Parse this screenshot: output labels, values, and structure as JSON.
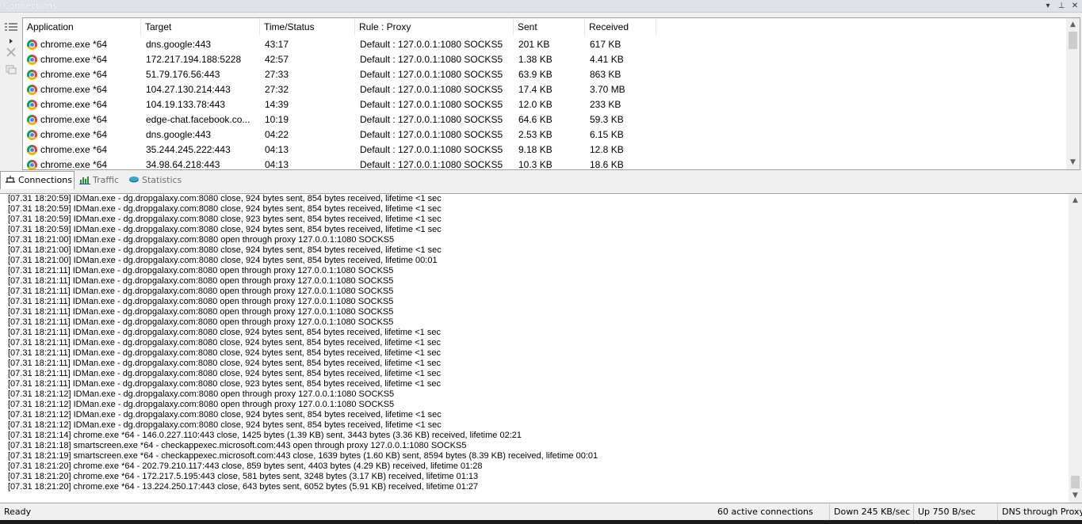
{
  "window": {
    "title": "Connections",
    "controls": {
      "dropdown": "▾",
      "pin": "⊥",
      "close": "✕"
    }
  },
  "connections": {
    "columns": [
      "Application",
      "Target",
      "Time/Status",
      "Rule : Proxy",
      "Sent",
      "Received"
    ],
    "rows": [
      [
        "chrome.exe *64",
        "dns.google:443",
        "43:17",
        "Default : 127.0.0.1:1080 SOCKS5",
        "201 KB",
        "617 KB"
      ],
      [
        "chrome.exe *64",
        "172.217.194.188:5228",
        "42:57",
        "Default : 127.0.0.1:1080 SOCKS5",
        "1.38 KB",
        "4.41 KB"
      ],
      [
        "chrome.exe *64",
        "51.79.176.56:443",
        "27:33",
        "Default : 127.0.0.1:1080 SOCKS5",
        "63.9 KB",
        "863 KB"
      ],
      [
        "chrome.exe *64",
        "104.27.130.214:443",
        "27:32",
        "Default : 127.0.0.1:1080 SOCKS5",
        "17.4 KB",
        "3.70 MB"
      ],
      [
        "chrome.exe *64",
        "104.19.133.78:443",
        "14:39",
        "Default : 127.0.0.1:1080 SOCKS5",
        "12.0 KB",
        "233 KB"
      ],
      [
        "chrome.exe *64",
        "edge-chat.facebook.co...",
        "10:19",
        "Default : 127.0.0.1:1080 SOCKS5",
        "64.6 KB",
        "59.3 KB"
      ],
      [
        "chrome.exe *64",
        "dns.google:443",
        "04:22",
        "Default : 127.0.0.1:1080 SOCKS5",
        "2.53 KB",
        "6.15 KB"
      ],
      [
        "chrome.exe *64",
        "35.244.245.222:443",
        "04:13",
        "Default : 127.0.0.1:1080 SOCKS5",
        "9.18 KB",
        "12.8 KB"
      ],
      [
        "chrome.exe *64",
        "34.98.64.218:443",
        "04:13",
        "Default : 127.0.0.1:1080 SOCKS5",
        "10.3 KB",
        "18.6 KB"
      ]
    ]
  },
  "tabs": [
    {
      "label": "Connections",
      "icon": "connections-icon"
    },
    {
      "label": "Traffic",
      "icon": "traffic-chart-icon"
    },
    {
      "label": "Statistics",
      "icon": "statistics-icon"
    }
  ],
  "log": [
    "[07.31 18:20:59] IDMan.exe - dg.dropgalaxy.com:8080 close, 924 bytes sent, 854 bytes received, lifetime <1 sec",
    "[07.31 18:20:59] IDMan.exe - dg.dropgalaxy.com:8080 close, 924 bytes sent, 854 bytes received, lifetime <1 sec",
    "[07.31 18:20:59] IDMan.exe - dg.dropgalaxy.com:8080 close, 923 bytes sent, 854 bytes received, lifetime <1 sec",
    "[07.31 18:20:59] IDMan.exe - dg.dropgalaxy.com:8080 close, 924 bytes sent, 854 bytes received, lifetime <1 sec",
    "[07.31 18:21:00] IDMan.exe - dg.dropgalaxy.com:8080 open through proxy 127.0.0.1:1080 SOCKS5",
    "[07.31 18:21:00] IDMan.exe - dg.dropgalaxy.com:8080 close, 924 bytes sent, 854 bytes received, lifetime <1 sec",
    "[07.31 18:21:00] IDMan.exe - dg.dropgalaxy.com:8080 close, 924 bytes sent, 854 bytes received, lifetime 00:01",
    "[07.31 18:21:11] IDMan.exe - dg.dropgalaxy.com:8080 open through proxy 127.0.0.1:1080 SOCKS5",
    "[07.31 18:21:11] IDMan.exe - dg.dropgalaxy.com:8080 open through proxy 127.0.0.1:1080 SOCKS5",
    "[07.31 18:21:11] IDMan.exe - dg.dropgalaxy.com:8080 open through proxy 127.0.0.1:1080 SOCKS5",
    "[07.31 18:21:11] IDMan.exe - dg.dropgalaxy.com:8080 open through proxy 127.0.0.1:1080 SOCKS5",
    "[07.31 18:21:11] IDMan.exe - dg.dropgalaxy.com:8080 open through proxy 127.0.0.1:1080 SOCKS5",
    "[07.31 18:21:11] IDMan.exe - dg.dropgalaxy.com:8080 open through proxy 127.0.0.1:1080 SOCKS5",
    "[07.31 18:21:11] IDMan.exe - dg.dropgalaxy.com:8080 close, 924 bytes sent, 854 bytes received, lifetime <1 sec",
    "[07.31 18:21:11] IDMan.exe - dg.dropgalaxy.com:8080 close, 924 bytes sent, 854 bytes received, lifetime <1 sec",
    "[07.31 18:21:11] IDMan.exe - dg.dropgalaxy.com:8080 close, 924 bytes sent, 854 bytes received, lifetime <1 sec",
    "[07.31 18:21:11] IDMan.exe - dg.dropgalaxy.com:8080 close, 924 bytes sent, 854 bytes received, lifetime <1 sec",
    "[07.31 18:21:11] IDMan.exe - dg.dropgalaxy.com:8080 close, 924 bytes sent, 854 bytes received, lifetime <1 sec",
    "[07.31 18:21:11] IDMan.exe - dg.dropgalaxy.com:8080 close, 923 bytes sent, 854 bytes received, lifetime <1 sec",
    "[07.31 18:21:12] IDMan.exe - dg.dropgalaxy.com:8080 open through proxy 127.0.0.1:1080 SOCKS5",
    "[07.31 18:21:12] IDMan.exe - dg.dropgalaxy.com:8080 open through proxy 127.0.0.1:1080 SOCKS5",
    "[07.31 18:21:12] IDMan.exe - dg.dropgalaxy.com:8080 close, 924 bytes sent, 854 bytes received, lifetime <1 sec",
    "[07.31 18:21:12] IDMan.exe - dg.dropgalaxy.com:8080 close, 924 bytes sent, 854 bytes received, lifetime <1 sec",
    "[07.31 18:21:14] chrome.exe *64 - 146.0.227.110:443 close, 1425 bytes (1.39 KB) sent, 3443 bytes (3.36 KB) received, lifetime 02:21",
    "[07.31 18:21:18] smartscreen.exe *64 - checkappexec.microsoft.com:443 open through proxy 127.0.0.1:1080 SOCKS5",
    "[07.31 18:21:19] smartscreen.exe *64 - checkappexec.microsoft.com:443 close, 1639 bytes (1.60 KB) sent, 8594 bytes (8.39 KB) received, lifetime 00:01",
    "[07.31 18:21:20] chrome.exe *64 - 202.79.210.117:443 close, 859 bytes sent, 4403 bytes (4.29 KB) received, lifetime 01:28",
    "[07.31 18:21:20] chrome.exe *64 - 172.217.5.195:443 close, 581 bytes sent, 3248 bytes (3.17 KB) received, lifetime 01:13",
    "[07.31 18:21:20] chrome.exe *64 - 13.224.250.17:443 close, 643 bytes sent, 6052 bytes (5.91 KB) received, lifetime 01:27"
  ],
  "status": {
    "state": "Ready",
    "active": "60 active connections",
    "down": "Down 245 KB/sec",
    "up": "Up 750 B/sec",
    "dns": "DNS through Proxy"
  },
  "scroll": {
    "arrow_up": "▲",
    "arrow_down": "▼"
  }
}
